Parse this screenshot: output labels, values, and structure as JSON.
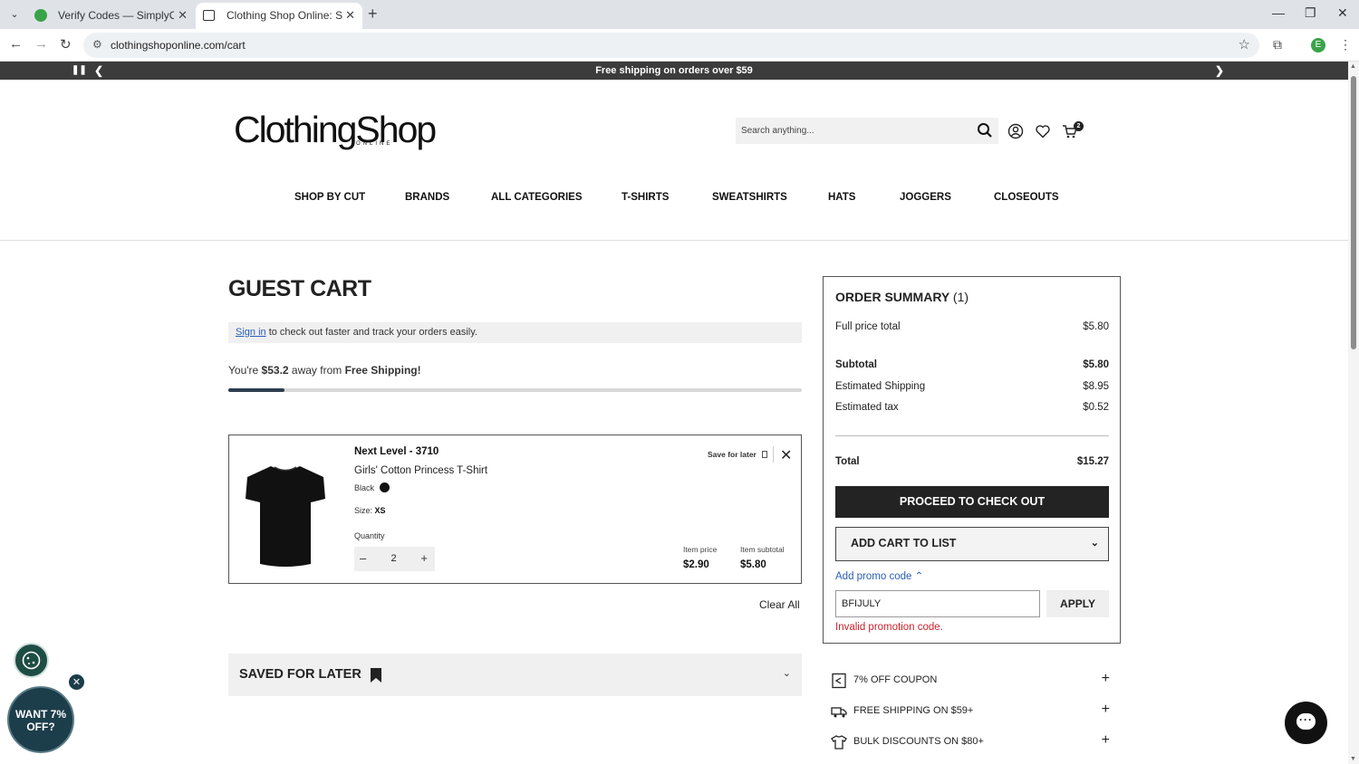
{
  "browser": {
    "tabs": [
      {
        "title": "Verify Codes — SimplyCodes",
        "active": false
      },
      {
        "title": "Clothing Shop Online: Shopping",
        "active": true
      }
    ],
    "url": "clothingshoponline.com/cart",
    "profile_initial": "E"
  },
  "promo_bar": {
    "text": "Free shipping on orders over $59"
  },
  "header": {
    "logo": "ClothingShop",
    "logo_sub": "ONLINE",
    "search_placeholder": "Search anything...",
    "cart_count": "2"
  },
  "nav": {
    "items": [
      "SHOP BY CUT",
      "BRANDS",
      "ALL CATEGORIES",
      "T-SHIRTS",
      "SWEATSHIRTS",
      "HATS",
      "JOGGERS",
      "CLOSEOUTS"
    ]
  },
  "cart": {
    "title": "GUEST CART",
    "signin_link": "Sign in",
    "signin_text": " to check out faster and track your orders easily.",
    "shipping_prefix": "You're ",
    "shipping_amount": "$53.2",
    "shipping_mid": " away from ",
    "shipping_goal": "Free Shipping!",
    "shipping_progress": 0.098,
    "item": {
      "brand": "Next Level - 3710",
      "name": "Girls' Cotton Princess T-Shirt",
      "color": "Black",
      "size_label": "Size:",
      "size": "XS",
      "quantity_label": "Quantity",
      "quantity": "2",
      "save_later": "Save for later",
      "item_price_label": "Item price",
      "item_price": "$2.90",
      "item_subtotal_label": "Item subtotal",
      "item_subtotal": "$5.80"
    },
    "clear_all": "Clear All",
    "saved_for_later": "SAVED FOR LATER"
  },
  "summary": {
    "title": "ORDER SUMMARY",
    "count": "(1)",
    "full_price_label": "Full price total",
    "full_price": "$5.80",
    "subtotal_label": "Subtotal",
    "subtotal": "$5.80",
    "shipping_label": "Estimated Shipping",
    "shipping": "$8.95",
    "tax_label": "Estimated tax",
    "tax": "$0.52",
    "total_label": "Total",
    "total": "$15.27",
    "checkout": "PROCEED TO CHECK OUT",
    "add_to_list": "ADD CART TO LIST",
    "promo_toggle": "Add promo code",
    "promo_value": "BFIJULY",
    "apply": "APPLY",
    "promo_error": "Invalid promotion code."
  },
  "perks": [
    {
      "label": "7% OFF COUPON",
      "icon": "coupon-icon"
    },
    {
      "label": "FREE SHIPPING ON $59+",
      "icon": "truck-icon"
    },
    {
      "label": "BULK DISCOUNTS ON $80+",
      "icon": "shirt-icon"
    }
  ],
  "widgets": {
    "want_off": "WANT 7% OFF?"
  }
}
